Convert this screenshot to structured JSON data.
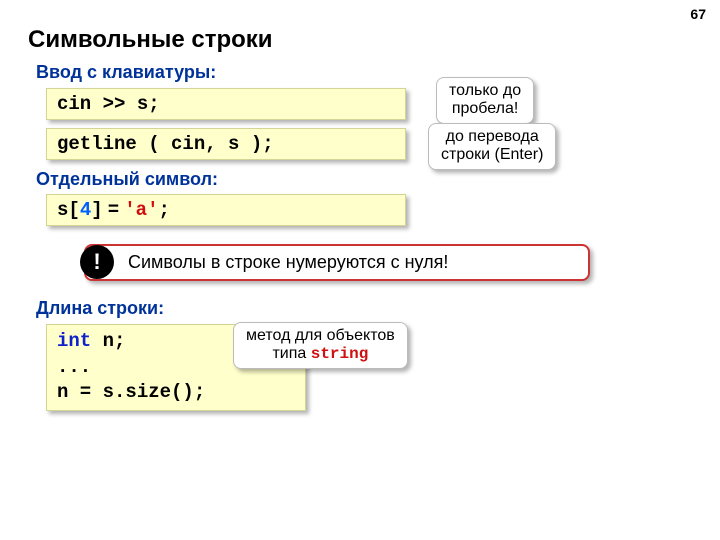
{
  "page_number": "67",
  "title": "Символьные строки",
  "sections": {
    "input": {
      "label": "Ввод с клавиатуры:"
    },
    "char": {
      "label": "Отдельный символ:"
    },
    "length": {
      "label": "Длина строки:"
    }
  },
  "code": {
    "cin_line": "cin >> s;",
    "getline_line": "getline ( cin, s );",
    "index_line": {
      "a": "s[",
      "idx": "4",
      "b": "]",
      "c": " = ",
      "q1": "'a'",
      "d": ";"
    },
    "length_block": {
      "kw": "int",
      "rest1": " n;",
      "line2": "...",
      "line3a": "n = s.size();"
    }
  },
  "callouts": {
    "probela": "только до\nпробела!",
    "enter": "до перевода\nстроки (Enter)",
    "method": {
      "a": "метод для объектов\nтипа ",
      "kw": "string"
    }
  },
  "warn": {
    "bang": "!",
    "text": "Символы в строке нумеруются с нуля!"
  }
}
